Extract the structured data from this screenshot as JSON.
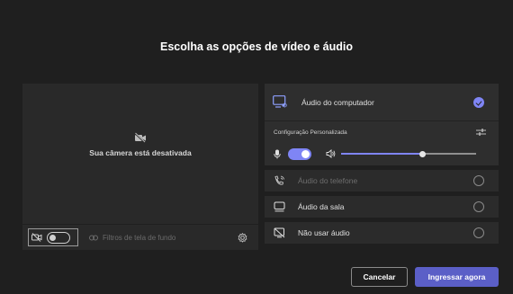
{
  "dialog": {
    "title": "Escolha as opções de vídeo e áudio"
  },
  "camera": {
    "off_text": "Sua câmera está desativada",
    "toggle_state": "off",
    "background_filters_label": "Filtros de tela de fundo"
  },
  "audio": {
    "computer": {
      "label": "Áudio do computador",
      "selected": true,
      "config_label": "Configuração Personalizada",
      "mic_toggle": "on",
      "volume_level": 0.6
    },
    "options": [
      {
        "label": "Áudio do telefone",
        "icon": "phone-icon",
        "enabled": false
      },
      {
        "label": "Áudio da sala",
        "icon": "room-icon",
        "enabled": true
      },
      {
        "label": "Não usar áudio",
        "icon": "no-audio-icon",
        "enabled": true
      }
    ]
  },
  "buttons": {
    "cancel": "Cancelar",
    "join": "Ingressar agora"
  },
  "colors": {
    "accent": "#7f85f5",
    "primary_button": "#5b5fc7",
    "background": "#1f1f1f",
    "panel": "#292929"
  }
}
